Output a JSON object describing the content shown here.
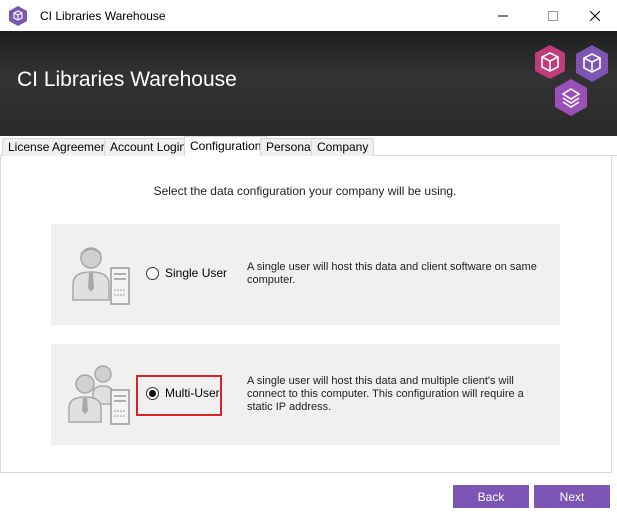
{
  "window": {
    "title": "CI Libraries Warehouse",
    "icon": "box-hexagon-icon",
    "controls": [
      "minimize-icon",
      "maximize-icon",
      "close-icon"
    ]
  },
  "header": {
    "title": "CI Libraries Warehouse",
    "logo": "hexagon-cluster-logo"
  },
  "tabs": [
    {
      "label": "License Agreement",
      "active": false
    },
    {
      "label": "Account Login",
      "active": false
    },
    {
      "label": "Configuration",
      "active": true
    },
    {
      "label": "Personal",
      "active": false
    },
    {
      "label": "Company",
      "active": false
    }
  ],
  "main": {
    "instruction": "Select the data configuration your company will be using.",
    "options": [
      {
        "label": "Single User",
        "selected": false,
        "icon": "single-user-server-icon",
        "description": "A single user will host this data and client software on same computer."
      },
      {
        "label": "Multi-User",
        "selected": true,
        "icon": "multi-user-server-icon",
        "description": "A single user will host this data and multiple client's will connect to this computer. This configuration will require a static IP address."
      }
    ]
  },
  "footer": {
    "back_label": "Back",
    "next_label": "Next"
  },
  "colors": {
    "accent": "#7c55b5",
    "highlight": "#d9232a",
    "banner": "#2a2a2a",
    "card": "#f0f0f0"
  }
}
